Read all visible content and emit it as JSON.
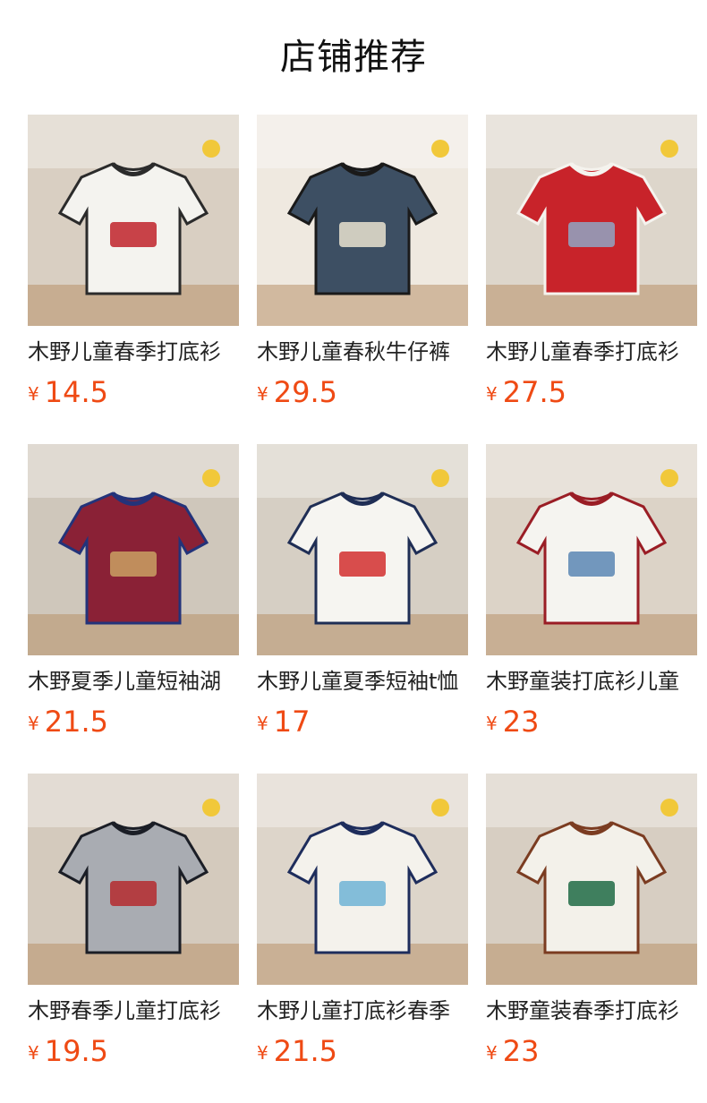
{
  "page_title": "店铺推荐",
  "currency": "¥",
  "products": [
    {
      "name": "木野儿童春季打底衫",
      "price": "14.5",
      "image": "product-photo-white-tees",
      "colors": {
        "bg": "#d9cfc2",
        "main": "#f4f3ef",
        "accent": "#2b2b2b",
        "accent2": "#c0222a"
      }
    },
    {
      "name": "木野儿童春秋牛仔裤",
      "price": "29.5",
      "image": "product-photo-denim-jeans",
      "colors": {
        "bg": "#efe9e0",
        "main": "#3d4f63",
        "accent": "#1a1a1a",
        "accent2": "#e9e2cf"
      }
    },
    {
      "name": "木野儿童春季打底衫",
      "price": "27.5",
      "image": "product-photo-red-stripe-tee",
      "colors": {
        "bg": "#ddd6cb",
        "main": "#c8232a",
        "accent": "#f5f3ee",
        "accent2": "#8fa6c4"
      }
    },
    {
      "name": "木野夏季儿童短袖湖",
      "price": "21.5",
      "image": "product-photo-striped-tees",
      "colors": {
        "bg": "#cfc7bb",
        "main": "#8a2136",
        "accent": "#23337a",
        "accent2": "#c9a063"
      }
    },
    {
      "name": "木野儿童夏季短袖t恤",
      "price": "17",
      "image": "product-photo-white-tee-shorts",
      "colors": {
        "bg": "#d6cfc4",
        "main": "#f6f5f1",
        "accent": "#1f2e55",
        "accent2": "#d22f2f"
      }
    },
    {
      "name": "木野童装打底衫儿童",
      "price": "23",
      "image": "product-photo-23-tee",
      "colors": {
        "bg": "#dcd3c7",
        "main": "#f5f4f0",
        "accent": "#9a1d25",
        "accent2": "#5a86b4"
      }
    },
    {
      "name": "木野春季儿童打底衫",
      "price": "19.5",
      "image": "product-photo-grey-raglan",
      "colors": {
        "bg": "#d4cabd",
        "main": "#a9acb2",
        "accent": "#1b1e26",
        "accent2": "#b52a2e"
      }
    },
    {
      "name": "木野儿童打底衫春季",
      "price": "21.5",
      "image": "product-photo-camping-raglan",
      "colors": {
        "bg": "#ddd5ca",
        "main": "#f4f2ec",
        "accent": "#1e2d5c",
        "accent2": "#6fb4d6"
      }
    },
    {
      "name": "木野童装春季打底衫",
      "price": "23",
      "image": "product-photo-color-raglans",
      "colors": {
        "bg": "#d7cec2",
        "main": "#f3f1ea",
        "accent": "#7b3c21",
        "accent2": "#1f6b45"
      }
    }
  ]
}
